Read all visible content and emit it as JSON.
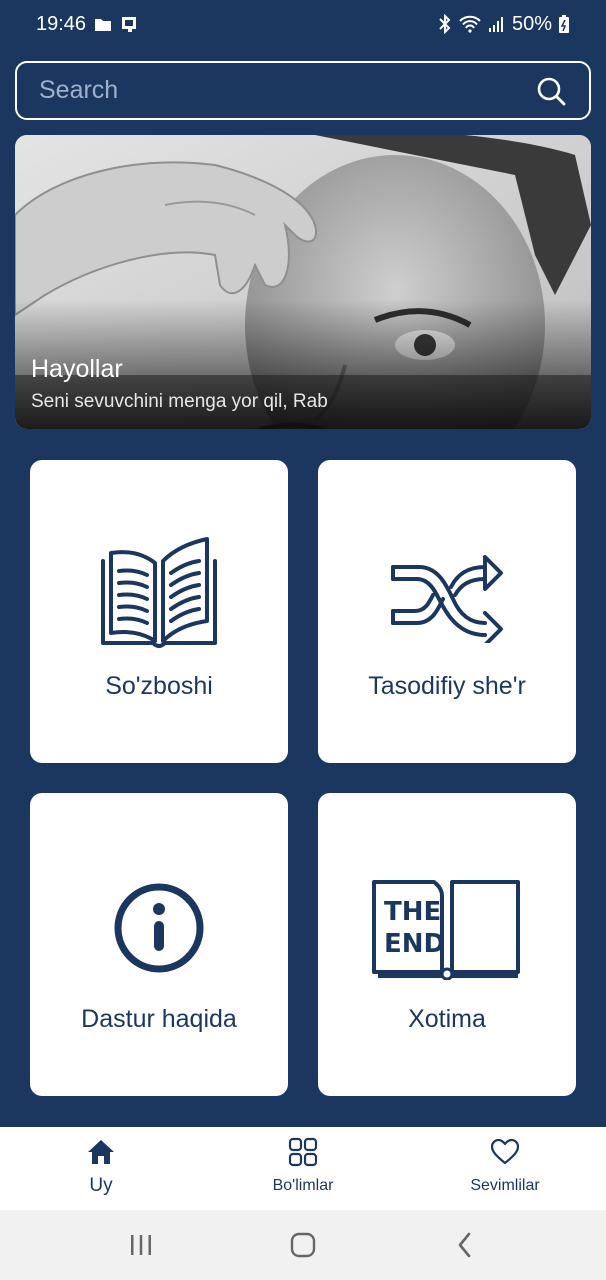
{
  "status_bar": {
    "time": "19:46",
    "battery": "50%",
    "icons": [
      "folder-icon",
      "sim-card-icon",
      "bluetooth-icon",
      "wifi-icon",
      "signal-icon",
      "battery-icon"
    ]
  },
  "search": {
    "placeholder": "Search",
    "icon": "search-icon"
  },
  "hero": {
    "title": "Hayollar",
    "subtitle": "Seni sevuvchini menga yor qil, Rab"
  },
  "cards": [
    {
      "label": "So'zboshi",
      "icon": "open-book-icon"
    },
    {
      "label": "Tasodifiy she'r",
      "icon": "shuffle-icon"
    },
    {
      "label": "Dastur haqida",
      "icon": "info-icon"
    },
    {
      "label": "Xotima",
      "icon": "the-end-book-icon",
      "icon_text_1": "THE",
      "icon_text_2": "END"
    }
  ],
  "bottom_nav": [
    {
      "label": "Uy",
      "icon": "home-icon",
      "active": true
    },
    {
      "label": "Bo'limlar",
      "icon": "grid-icon",
      "active": false
    },
    {
      "label": "Sevimlilar",
      "icon": "heart-icon",
      "active": false
    }
  ],
  "colors": {
    "background": "#1b365f",
    "card": "#ffffff",
    "accent": "#1b365f",
    "placeholder": "#9fb0cc",
    "system_nav": "#f1f1f1"
  }
}
